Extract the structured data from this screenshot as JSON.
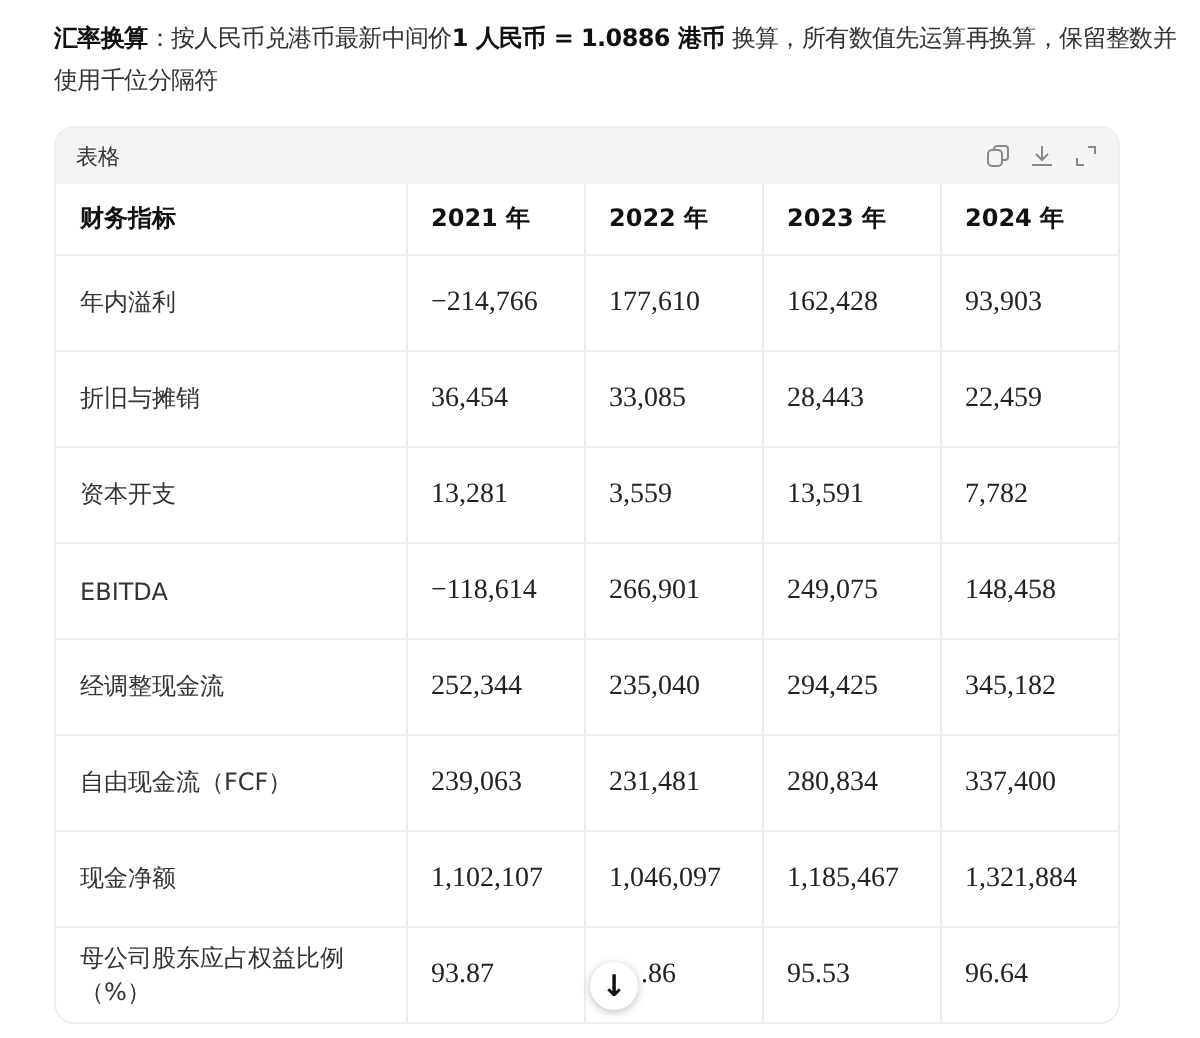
{
  "note": "**汇率换算**：按人民币兑港币最新中间价**1 人民币 = 1.0886 港币** 换算，所有数值先运算再换算，保留整数并使用千位分隔符",
  "table": {
    "title": "表格",
    "columns": [
      "财务指标",
      "2021 年",
      "2022 年",
      "2023 年",
      "2024 年"
    ],
    "rows": [
      [
        "年内溢利",
        "−214,766",
        "177,610",
        "162,428",
        "93,903"
      ],
      [
        "折旧与摊销",
        "36,454",
        "33,085",
        "28,443",
        "22,459"
      ],
      [
        "资本开支",
        "13,281",
        "3,559",
        "13,591",
        "7,782"
      ],
      [
        "EBITDA",
        "−118,614",
        "266,901",
        "249,075",
        "148,458"
      ],
      [
        "经调整现金流",
        "252,344",
        "235,040",
        "294,425",
        "345,182"
      ],
      [
        "自由现金流（FCF）",
        "239,063",
        "231,481",
        "280,834",
        "337,400"
      ],
      [
        "现金净额",
        "1,102,107",
        "1,046,097",
        "1,185,467",
        "1,321,884"
      ],
      [
        "母公司股东应占权益比例（%）",
        "93.87",
        ".86",
        "95.53",
        "96.64"
      ]
    ]
  },
  "scroll_button": "↓"
}
